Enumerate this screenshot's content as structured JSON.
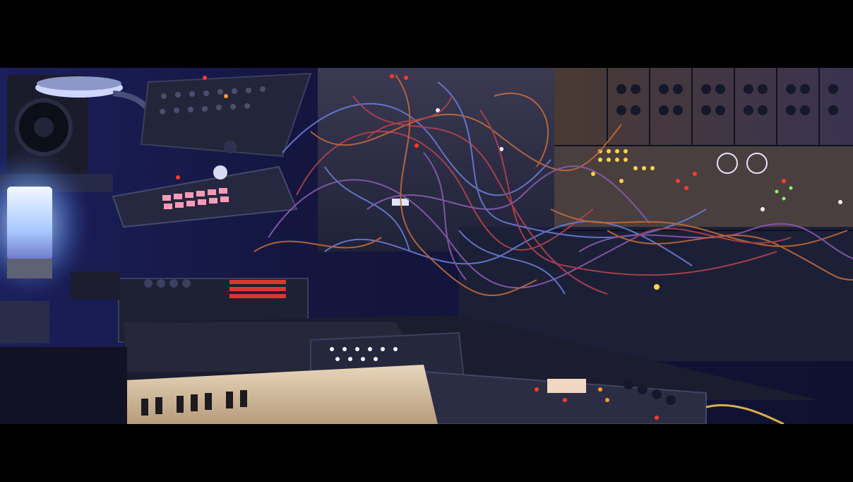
{
  "scene": {
    "description_kind": "photo",
    "palette": {
      "background": "#000000",
      "room": "#12143a",
      "room_light": "#2a2d7a",
      "lamp": "#e6f0ff",
      "panel_dark": "#1b1f33",
      "panel_mid": "#3a3f5e",
      "rack_gold": "#5b4a3a",
      "keyboard": "#d8c3a5",
      "led_red": "#ff3b2f",
      "led_orange": "#ff9a2a",
      "led_yellow": "#ffd24a",
      "led_white": "#f3f3ff",
      "led_green": "#7dff6a",
      "cable_red": "#b3424e",
      "cable_orange": "#c46a3a",
      "cable_blue": "#6b7bd6",
      "cable_purple": "#8a5ab0"
    }
  }
}
